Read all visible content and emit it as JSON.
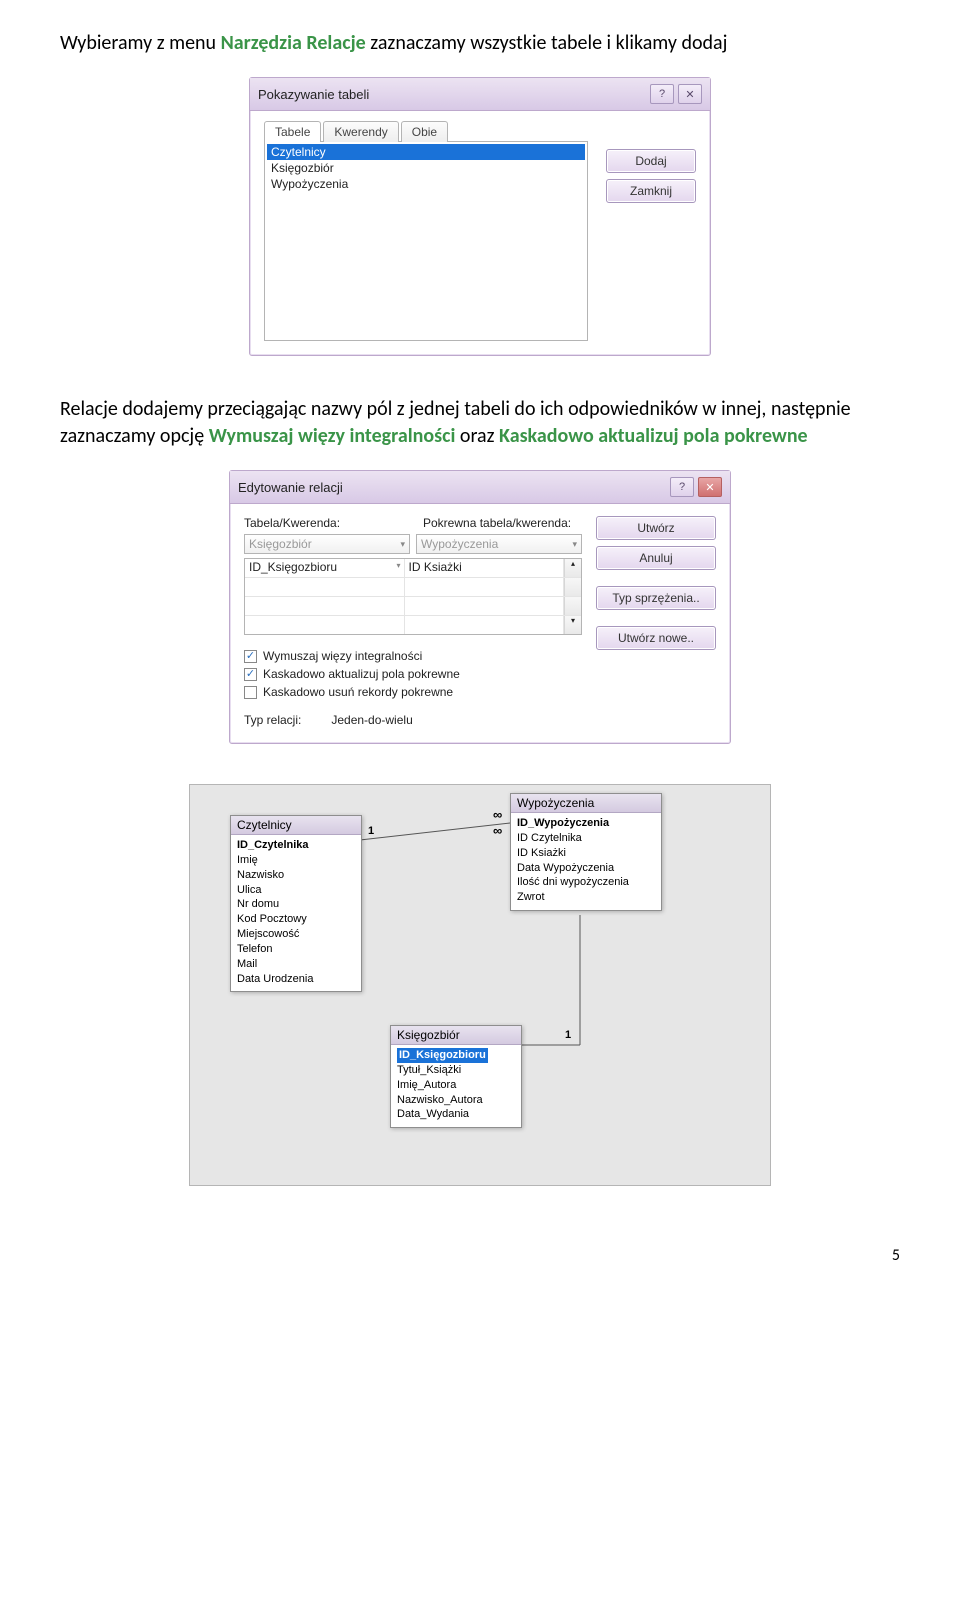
{
  "intro": {
    "p1_a": "Wybieramy z menu ",
    "p1_b": "Narzędzia Relacje",
    "p1_c": " zaznaczamy wszystkie tabele i klikamy dodaj",
    "p2_a": "Relacje dodajemy przeciągając nazwy pól z jednej tabeli do ich odpowiedników w innej, następnie zaznaczamy opcję ",
    "p2_b": "Wymuszaj więzy integralności",
    "p2_c": " oraz ",
    "p2_d": "Kaskadowo aktualizuj pola pokrewne"
  },
  "showtbl": {
    "title": "Pokazywanie tabeli",
    "help": "?",
    "close": "✕",
    "tabs": [
      "Tabele",
      "Kwerendy",
      "Obie"
    ],
    "items": [
      "Czytelnicy",
      "Księgozbiór",
      "Wypożyczenia"
    ],
    "btn_add": "Dodaj",
    "btn_close": "Zamknij"
  },
  "editrel": {
    "title": "Edytowanie relacji",
    "help": "?",
    "close": "✕",
    "lbl_tbl": "Tabela/Kwerenda:",
    "lbl_rel": "Pokrewna tabela/kwerenda:",
    "combo_a": "Księgozbiór",
    "combo_b": "Wypożyczenia",
    "col_a": "ID_Księgozbioru",
    "col_b": "ID Ksiażki",
    "chk1": "Wymuszaj więzy integralności",
    "chk2": "Kaskadowo aktualizuj pola pokrewne",
    "chk3": "Kaskadowo usuń rekordy pokrewne",
    "typ_lbl": "Typ relacji:",
    "typ_val": "Jeden-do-wielu",
    "btn_create": "Utwórz",
    "btn_cancel": "Anuluj",
    "btn_join": "Typ sprzężenia..",
    "btn_new": "Utwórz nowe.."
  },
  "diag": {
    "t1": {
      "title": "Czytelnicy",
      "fields": [
        "ID_Czytelnika",
        "Imię",
        "Nazwisko",
        "Ulica",
        "Nr domu",
        "Kod Pocztowy",
        "Miejscowość",
        "Telefon",
        "Mail",
        "Data Urodzenia"
      ]
    },
    "t2": {
      "title": "Wypożyczenia",
      "fields": [
        "ID_Wypożyczenia",
        "ID Czytelnika",
        "ID Ksiażki",
        "Data Wypożyczenia",
        "Ilość dni wypożyczenia",
        "Zwrot"
      ]
    },
    "t3": {
      "title": "Księgozbiór",
      "fields": [
        "ID_Księgozbioru",
        "Tytuł_Książki",
        "Imię_Autora",
        "Nazwisko_Autora",
        "Data_Wydania"
      ]
    },
    "one": "1",
    "inf": "∞"
  },
  "pagenum": "5"
}
